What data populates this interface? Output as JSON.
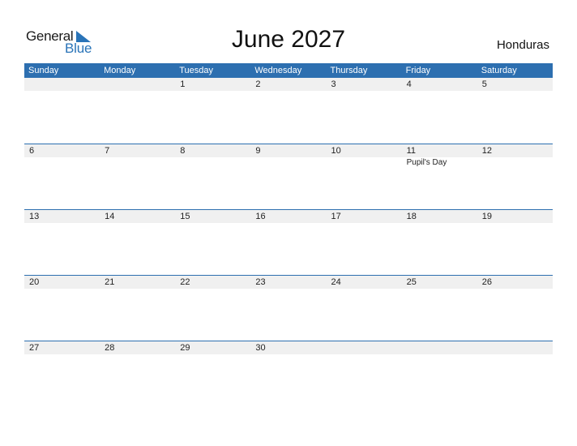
{
  "logo": {
    "general": "General",
    "blue": "Blue",
    "icon": "triangle-flag-icon"
  },
  "title": "June 2027",
  "country": "Honduras",
  "colors": {
    "accent": "#2d6fb0",
    "date_strip": "#f0f0f0"
  },
  "day_headers": [
    "Sunday",
    "Monday",
    "Tuesday",
    "Wednesday",
    "Thursday",
    "Friday",
    "Saturday"
  ],
  "weeks": [
    {
      "days": [
        {
          "num": "",
          "event": ""
        },
        {
          "num": "",
          "event": ""
        },
        {
          "num": "1",
          "event": ""
        },
        {
          "num": "2",
          "event": ""
        },
        {
          "num": "3",
          "event": ""
        },
        {
          "num": "4",
          "event": ""
        },
        {
          "num": "5",
          "event": ""
        }
      ]
    },
    {
      "days": [
        {
          "num": "6",
          "event": ""
        },
        {
          "num": "7",
          "event": ""
        },
        {
          "num": "8",
          "event": ""
        },
        {
          "num": "9",
          "event": ""
        },
        {
          "num": "10",
          "event": ""
        },
        {
          "num": "11",
          "event": "Pupil's Day"
        },
        {
          "num": "12",
          "event": ""
        }
      ]
    },
    {
      "days": [
        {
          "num": "13",
          "event": ""
        },
        {
          "num": "14",
          "event": ""
        },
        {
          "num": "15",
          "event": ""
        },
        {
          "num": "16",
          "event": ""
        },
        {
          "num": "17",
          "event": ""
        },
        {
          "num": "18",
          "event": ""
        },
        {
          "num": "19",
          "event": ""
        }
      ]
    },
    {
      "days": [
        {
          "num": "20",
          "event": ""
        },
        {
          "num": "21",
          "event": ""
        },
        {
          "num": "22",
          "event": ""
        },
        {
          "num": "23",
          "event": ""
        },
        {
          "num": "24",
          "event": ""
        },
        {
          "num": "25",
          "event": ""
        },
        {
          "num": "26",
          "event": ""
        }
      ]
    },
    {
      "days": [
        {
          "num": "27",
          "event": ""
        },
        {
          "num": "28",
          "event": ""
        },
        {
          "num": "29",
          "event": ""
        },
        {
          "num": "30",
          "event": ""
        },
        {
          "num": "",
          "event": ""
        },
        {
          "num": "",
          "event": ""
        },
        {
          "num": "",
          "event": ""
        }
      ]
    }
  ]
}
